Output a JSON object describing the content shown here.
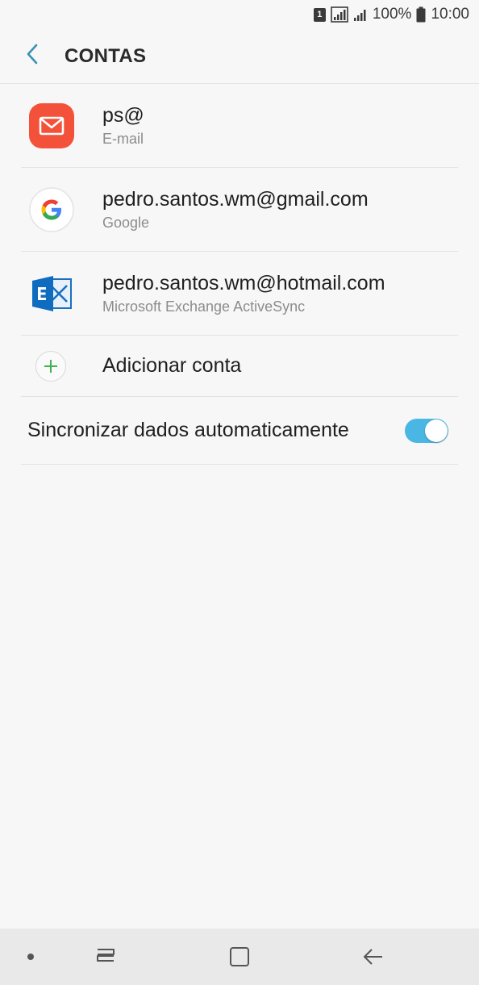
{
  "status_bar": {
    "sim_label": "1",
    "battery_percent": "100%",
    "time": "10:00",
    "icons": [
      "sim-card-icon",
      "signal-strength-icon",
      "signal-strength-icon",
      "battery-icon"
    ]
  },
  "header": {
    "title": "CONTAS",
    "back_icon": "chevron-left-icon"
  },
  "accounts": [
    {
      "name": "ps@",
      "type": "E-mail",
      "icon": "email-app-icon",
      "color": "#f4513a"
    },
    {
      "name": "pedro.santos.wm@gmail.com",
      "type": "Google",
      "icon": "google-icon",
      "color": "#4285f4"
    },
    {
      "name": "pedro.santos.wm@hotmail.com",
      "type": "Microsoft Exchange ActiveSync",
      "icon": "exchange-icon",
      "color": "#0f6cbf"
    }
  ],
  "add_account": {
    "label": "Adicionar conta",
    "icon": "plus-icon",
    "icon_color": "#3fb34f"
  },
  "auto_sync": {
    "label": "Sincronizar dados automaticamente",
    "enabled": true,
    "accent": "#4ab6e3"
  },
  "nav_bar": {
    "icons": [
      "dot-icon",
      "recents-icon",
      "home-icon",
      "back-arrow-icon"
    ]
  }
}
